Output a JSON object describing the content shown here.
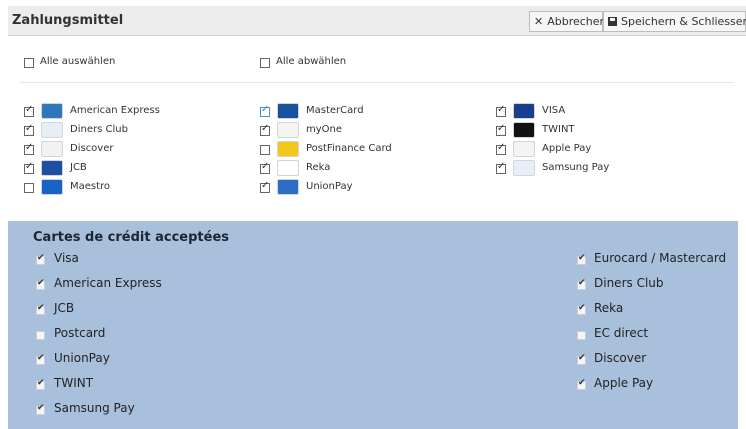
{
  "dialog": {
    "title": "Zahlungsmittel",
    "cancel_label": "Abbrechen",
    "save_label": "Speichern & Schliessen",
    "select_all_label": "Alle auswählen",
    "deselect_all_label": "Alle abwählen"
  },
  "payment_methods": [
    {
      "label": "American Express",
      "checked": true,
      "icon": "amex-logo-icon",
      "color": "#2e77bc"
    },
    {
      "label": "Diners Club",
      "checked": true,
      "icon": "discover-logo-icon",
      "color": "#e8eef6"
    },
    {
      "label": "Discover",
      "checked": true,
      "icon": "discover-card-icon",
      "color": "#f2f2f2"
    },
    {
      "label": "JCB",
      "checked": true,
      "icon": "jcb-logo-icon",
      "color": "#1e4ea1"
    },
    {
      "label": "Maestro",
      "checked": false,
      "icon": "maestro-logo-icon",
      "color": "#1a63c6"
    },
    {
      "label": "MasterCard",
      "checked": true,
      "icon": "mastercard-logo-icon",
      "color": "#1b4f9f"
    },
    {
      "label": "myOne",
      "checked": true,
      "icon": "myone-card-icon",
      "color": "#f4f4f4"
    },
    {
      "label": "PostFinance Card",
      "checked": false,
      "icon": "postfinance-logo-icon",
      "color": "#f5c518"
    },
    {
      "label": "Reka",
      "checked": true,
      "icon": "reka-logo-icon",
      "color": "#ffffff"
    },
    {
      "label": "UnionPay",
      "checked": true,
      "icon": "unionpay-logo-icon",
      "color": "#2b6fc4"
    },
    {
      "label": "VISA",
      "checked": true,
      "icon": "visa-logo-icon",
      "color": "#1a3d8f"
    },
    {
      "label": "TWINT",
      "checked": true,
      "icon": "twint-logo-icon",
      "color": "#111111"
    },
    {
      "label": "Apple Pay",
      "checked": true,
      "icon": "apple-pay-logo-icon",
      "color": "#f4f4f4"
    },
    {
      "label": "Samsung Pay",
      "checked": true,
      "icon": "samsung-pay-logo-icon",
      "color": "#e9eef6"
    }
  ],
  "accepted_cards": {
    "title": "Cartes de crédit acceptées",
    "left": [
      {
        "label": "Visa",
        "checked": true
      },
      {
        "label": "American Express",
        "checked": true
      },
      {
        "label": "JCB",
        "checked": true
      },
      {
        "label": "Postcard",
        "checked": false
      },
      {
        "label": "UnionPay",
        "checked": true
      },
      {
        "label": "TWINT",
        "checked": true
      },
      {
        "label": "Samsung Pay",
        "checked": true
      }
    ],
    "right": [
      {
        "label": "Eurocard / Mastercard",
        "checked": true
      },
      {
        "label": "Diners Club",
        "checked": true
      },
      {
        "label": "Reka",
        "checked": true
      },
      {
        "label": "EC direct",
        "checked": false
      },
      {
        "label": "Discover",
        "checked": true
      },
      {
        "label": "Apple Pay",
        "checked": true
      }
    ]
  },
  "colors": {
    "panel_background": "#a9c0dc",
    "header_background": "#ececec"
  }
}
